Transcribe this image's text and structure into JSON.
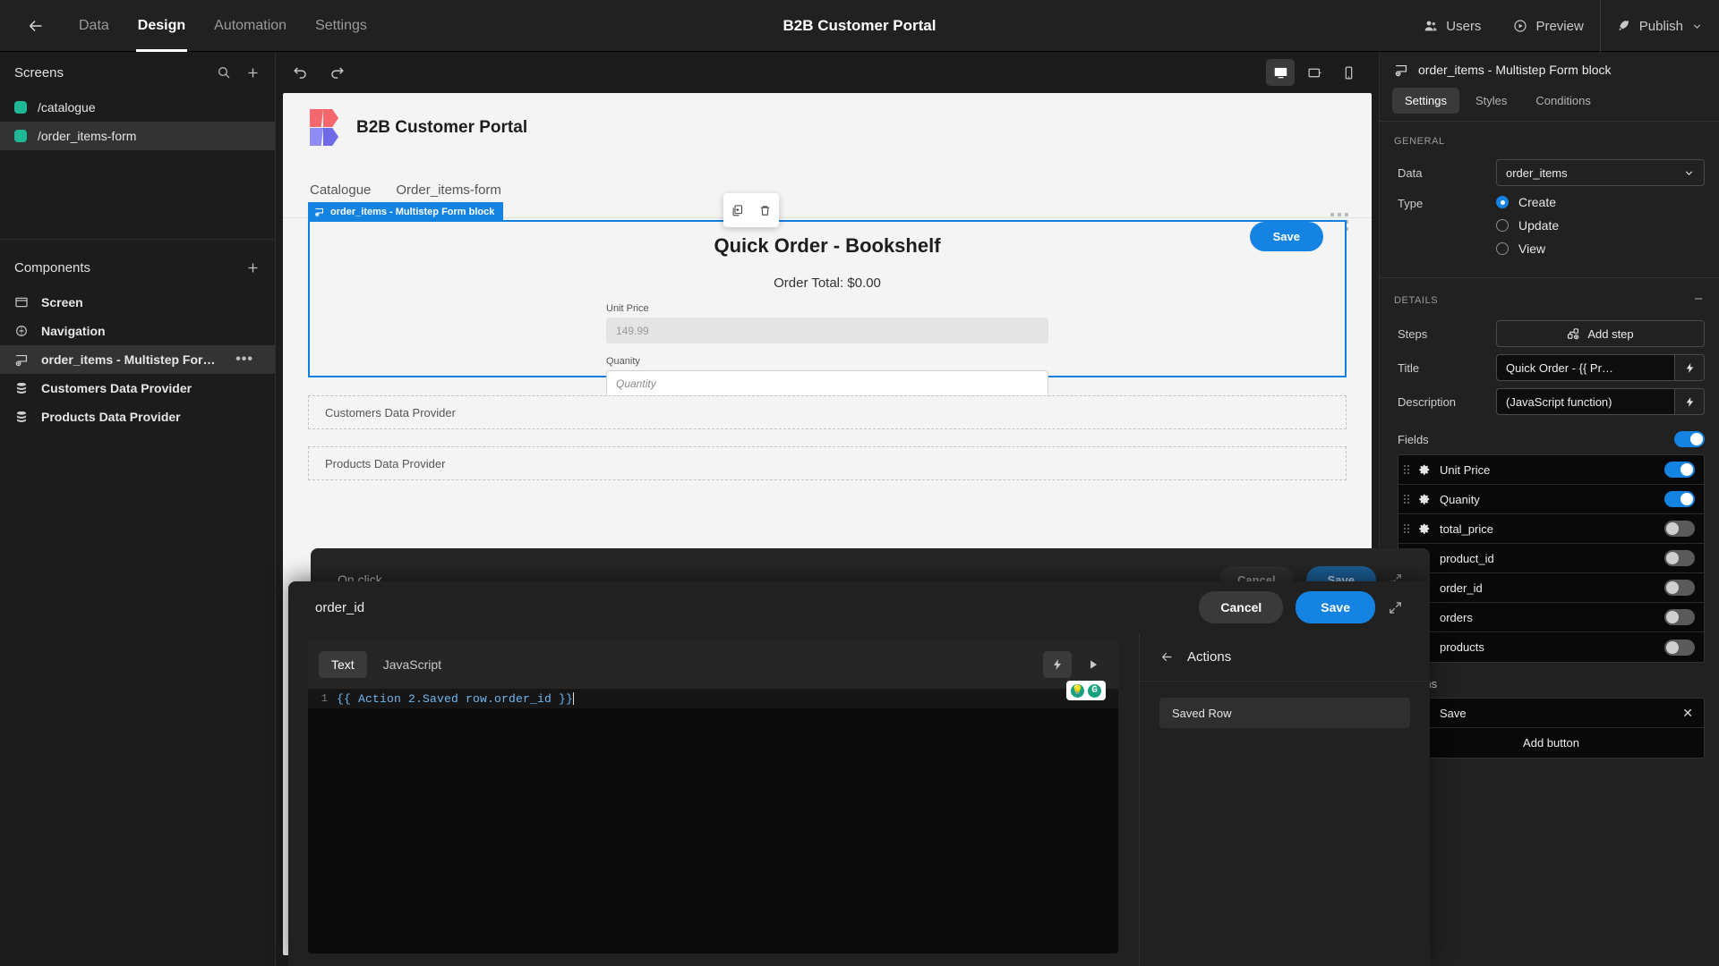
{
  "topbar": {
    "back_icon": "arrow-left-icon",
    "tabs": [
      {
        "label": "Data",
        "active": false
      },
      {
        "label": "Design",
        "active": true
      },
      {
        "label": "Automation",
        "active": false
      },
      {
        "label": "Settings",
        "active": false
      }
    ],
    "title": "B2B Customer Portal",
    "users_label": "Users",
    "preview_label": "Preview",
    "publish_label": "Publish"
  },
  "sidebar": {
    "screens_title": "Screens",
    "screens": [
      {
        "label": "/catalogue",
        "active": false,
        "color": "#1eb896"
      },
      {
        "label": "/order_items-form",
        "active": true,
        "color": "#1eb896"
      }
    ],
    "components_title": "Components",
    "components": [
      {
        "label": "Screen",
        "icon": "screen-icon",
        "active": false,
        "more": false
      },
      {
        "label": "Navigation",
        "icon": "navigation-icon",
        "active": false,
        "more": false
      },
      {
        "label": "order_items - Multistep For…",
        "icon": "form-block-icon",
        "active": true,
        "more": true
      },
      {
        "label": "Customers Data Provider",
        "icon": "database-icon",
        "active": false,
        "more": false
      },
      {
        "label": "Products Data Provider",
        "icon": "database-icon",
        "active": false,
        "more": false
      }
    ]
  },
  "canvas_toolbar": {
    "undo_icon": "undo-icon",
    "redo_icon": "redo-icon",
    "devices": [
      {
        "name": "desktop-icon",
        "active": true
      },
      {
        "name": "tablet-icon",
        "active": false
      },
      {
        "name": "mobile-icon",
        "active": false
      }
    ]
  },
  "canvas": {
    "brand": "B2B Customer Portal",
    "nav_links": [
      "Catalogue",
      "Order_items-form"
    ],
    "hover_toolbar": [
      "duplicate-icon",
      "delete-icon"
    ],
    "block_tag": "order_items - Multistep Form block",
    "form": {
      "title": "Quick Order - Bookshelf",
      "save_label": "Save",
      "order_total": "Order Total: $0.00",
      "fields": [
        {
          "label": "Unit Price",
          "value": "149.99",
          "readonly": true
        },
        {
          "label": "Quanity",
          "placeholder": "Quantity",
          "readonly": false
        }
      ]
    },
    "placeholders": [
      "Customers Data Provider",
      "Products Data Provider"
    ]
  },
  "right_panel": {
    "header_title": "order_items - Multistep Form block",
    "header_icon": "form-block-icon",
    "tabs": [
      {
        "label": "Settings",
        "active": true
      },
      {
        "label": "Styles",
        "active": false
      },
      {
        "label": "Conditions",
        "active": false
      }
    ],
    "general_title": "GENERAL",
    "data_label": "Data",
    "data_value": "order_items",
    "type_label": "Type",
    "type_options": [
      {
        "label": "Create",
        "selected": true
      },
      {
        "label": "Update",
        "selected": false
      },
      {
        "label": "View",
        "selected": false
      }
    ],
    "details_title": "DETAILS",
    "details_collapse_icon": "minus-icon",
    "steps_label": "Steps",
    "add_step_label": "Add step",
    "title_label": "Title",
    "title_value": "Quick Order - {{ Pr…",
    "description_label": "Description",
    "description_value": "(JavaScript function)",
    "fields_label": "Fields",
    "fields_master_on": true,
    "fields": [
      {
        "name": "Unit Price",
        "on": true
      },
      {
        "name": "Quanity",
        "on": true
      },
      {
        "name": "total_price",
        "on": false
      },
      {
        "name": "product_id",
        "on": false
      },
      {
        "name": "order_id",
        "on": false
      },
      {
        "name": "orders",
        "on": false
      },
      {
        "name": "products",
        "on": false
      }
    ],
    "buttons_label": "Buttons",
    "buttons": [
      {
        "name": "Save"
      }
    ],
    "add_button_label": "Add button"
  },
  "back_drawer": {
    "title": "On click",
    "cancel_label": "Cancel",
    "save_label": "Save",
    "expand_icon": "expand-icon"
  },
  "drawer": {
    "title": "order_id",
    "cancel_label": "Cancel",
    "save_label": "Save",
    "expand_icon": "expand-icon",
    "editor": {
      "tabs": [
        {
          "label": "Text",
          "active": true
        },
        {
          "label": "JavaScript",
          "active": false
        }
      ],
      "bolt_icon": "lightning-icon",
      "run_icon": "play-icon",
      "line_number": "1",
      "code": "{{ Action 2.Saved row.order_id }}",
      "grammarly_icons": [
        "lightbulb-icon",
        "grammarly-icon"
      ]
    },
    "actions": {
      "back_icon": "arrow-left-icon",
      "title": "Actions",
      "items": [
        "Saved Row"
      ]
    }
  }
}
